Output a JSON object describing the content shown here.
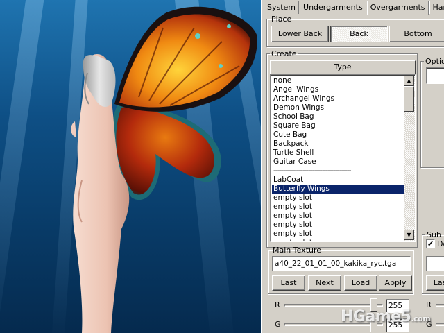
{
  "tabs": [
    "System",
    "Undergarments",
    "Overgarments",
    "Hands/F"
  ],
  "place": {
    "legend": "Place",
    "buttons": [
      "Lower Back",
      "Back",
      "Bottom"
    ],
    "selected": "Back"
  },
  "create": {
    "legend": "Create",
    "type_header": "Type",
    "items": [
      "none",
      "Angel Wings",
      "Archangel Wings",
      "Demon Wings",
      "School Bag",
      "Square Bag",
      "Cute Bag",
      "Backpack",
      "Turtle Shell",
      "Guitar Case",
      "----------------------------------------",
      "LabCoat",
      "Butterfly Wings",
      "empty slot",
      "empty slot",
      "empty slot",
      "empty slot",
      "empty slot",
      "empty slot"
    ],
    "selected": "Butterfly Wings"
  },
  "options": {
    "legend": "Optio"
  },
  "main_texture": {
    "legend": "Main Texture",
    "value": "a40_22_01_01_00_kakika_ryc.tga",
    "buttons": [
      "Last",
      "Next",
      "Load",
      "Apply"
    ]
  },
  "sub_texture": {
    "legend": "Sub T",
    "checkbox_label": "Do",
    "checked": true,
    "button": "Las"
  },
  "color": {
    "r_label": "R",
    "r_value": "255",
    "g_label": "G",
    "g_value": "255"
  },
  "watermark": {
    "main": "HGame5",
    "suffix": ".com"
  },
  "icons": {
    "scroll_up": "scroll-up-arrow-icon",
    "scroll_down": "scroll-down-arrow-icon"
  }
}
